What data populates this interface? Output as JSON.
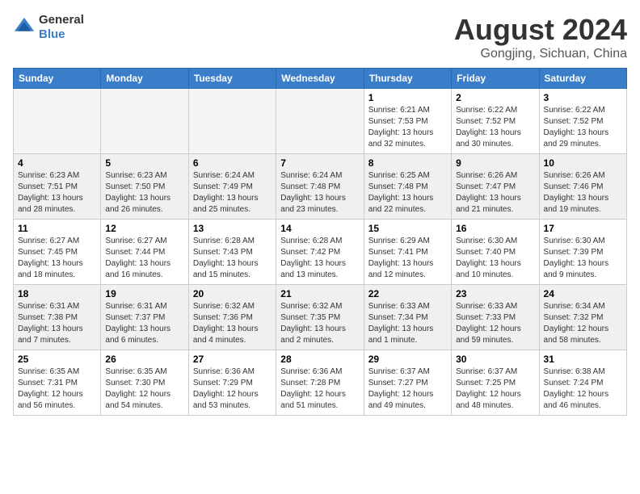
{
  "header": {
    "logo_general": "General",
    "logo_blue": "Blue",
    "month": "August 2024",
    "location": "Gongjing, Sichuan, China"
  },
  "weekdays": [
    "Sunday",
    "Monday",
    "Tuesday",
    "Wednesday",
    "Thursday",
    "Friday",
    "Saturday"
  ],
  "weeks": [
    [
      {
        "day": "",
        "info": ""
      },
      {
        "day": "",
        "info": ""
      },
      {
        "day": "",
        "info": ""
      },
      {
        "day": "",
        "info": ""
      },
      {
        "day": "1",
        "info": "Sunrise: 6:21 AM\nSunset: 7:53 PM\nDaylight: 13 hours\nand 32 minutes."
      },
      {
        "day": "2",
        "info": "Sunrise: 6:22 AM\nSunset: 7:52 PM\nDaylight: 13 hours\nand 30 minutes."
      },
      {
        "day": "3",
        "info": "Sunrise: 6:22 AM\nSunset: 7:52 PM\nDaylight: 13 hours\nand 29 minutes."
      }
    ],
    [
      {
        "day": "4",
        "info": "Sunrise: 6:23 AM\nSunset: 7:51 PM\nDaylight: 13 hours\nand 28 minutes."
      },
      {
        "day": "5",
        "info": "Sunrise: 6:23 AM\nSunset: 7:50 PM\nDaylight: 13 hours\nand 26 minutes."
      },
      {
        "day": "6",
        "info": "Sunrise: 6:24 AM\nSunset: 7:49 PM\nDaylight: 13 hours\nand 25 minutes."
      },
      {
        "day": "7",
        "info": "Sunrise: 6:24 AM\nSunset: 7:48 PM\nDaylight: 13 hours\nand 23 minutes."
      },
      {
        "day": "8",
        "info": "Sunrise: 6:25 AM\nSunset: 7:48 PM\nDaylight: 13 hours\nand 22 minutes."
      },
      {
        "day": "9",
        "info": "Sunrise: 6:26 AM\nSunset: 7:47 PM\nDaylight: 13 hours\nand 21 minutes."
      },
      {
        "day": "10",
        "info": "Sunrise: 6:26 AM\nSunset: 7:46 PM\nDaylight: 13 hours\nand 19 minutes."
      }
    ],
    [
      {
        "day": "11",
        "info": "Sunrise: 6:27 AM\nSunset: 7:45 PM\nDaylight: 13 hours\nand 18 minutes."
      },
      {
        "day": "12",
        "info": "Sunrise: 6:27 AM\nSunset: 7:44 PM\nDaylight: 13 hours\nand 16 minutes."
      },
      {
        "day": "13",
        "info": "Sunrise: 6:28 AM\nSunset: 7:43 PM\nDaylight: 13 hours\nand 15 minutes."
      },
      {
        "day": "14",
        "info": "Sunrise: 6:28 AM\nSunset: 7:42 PM\nDaylight: 13 hours\nand 13 minutes."
      },
      {
        "day": "15",
        "info": "Sunrise: 6:29 AM\nSunset: 7:41 PM\nDaylight: 13 hours\nand 12 minutes."
      },
      {
        "day": "16",
        "info": "Sunrise: 6:30 AM\nSunset: 7:40 PM\nDaylight: 13 hours\nand 10 minutes."
      },
      {
        "day": "17",
        "info": "Sunrise: 6:30 AM\nSunset: 7:39 PM\nDaylight: 13 hours\nand 9 minutes."
      }
    ],
    [
      {
        "day": "18",
        "info": "Sunrise: 6:31 AM\nSunset: 7:38 PM\nDaylight: 13 hours\nand 7 minutes."
      },
      {
        "day": "19",
        "info": "Sunrise: 6:31 AM\nSunset: 7:37 PM\nDaylight: 13 hours\nand 6 minutes."
      },
      {
        "day": "20",
        "info": "Sunrise: 6:32 AM\nSunset: 7:36 PM\nDaylight: 13 hours\nand 4 minutes."
      },
      {
        "day": "21",
        "info": "Sunrise: 6:32 AM\nSunset: 7:35 PM\nDaylight: 13 hours\nand 2 minutes."
      },
      {
        "day": "22",
        "info": "Sunrise: 6:33 AM\nSunset: 7:34 PM\nDaylight: 13 hours\nand 1 minute."
      },
      {
        "day": "23",
        "info": "Sunrise: 6:33 AM\nSunset: 7:33 PM\nDaylight: 12 hours\nand 59 minutes."
      },
      {
        "day": "24",
        "info": "Sunrise: 6:34 AM\nSunset: 7:32 PM\nDaylight: 12 hours\nand 58 minutes."
      }
    ],
    [
      {
        "day": "25",
        "info": "Sunrise: 6:35 AM\nSunset: 7:31 PM\nDaylight: 12 hours\nand 56 minutes."
      },
      {
        "day": "26",
        "info": "Sunrise: 6:35 AM\nSunset: 7:30 PM\nDaylight: 12 hours\nand 54 minutes."
      },
      {
        "day": "27",
        "info": "Sunrise: 6:36 AM\nSunset: 7:29 PM\nDaylight: 12 hours\nand 53 minutes."
      },
      {
        "day": "28",
        "info": "Sunrise: 6:36 AM\nSunset: 7:28 PM\nDaylight: 12 hours\nand 51 minutes."
      },
      {
        "day": "29",
        "info": "Sunrise: 6:37 AM\nSunset: 7:27 PM\nDaylight: 12 hours\nand 49 minutes."
      },
      {
        "day": "30",
        "info": "Sunrise: 6:37 AM\nSunset: 7:25 PM\nDaylight: 12 hours\nand 48 minutes."
      },
      {
        "day": "31",
        "info": "Sunrise: 6:38 AM\nSunset: 7:24 PM\nDaylight: 12 hours\nand 46 minutes."
      }
    ]
  ]
}
